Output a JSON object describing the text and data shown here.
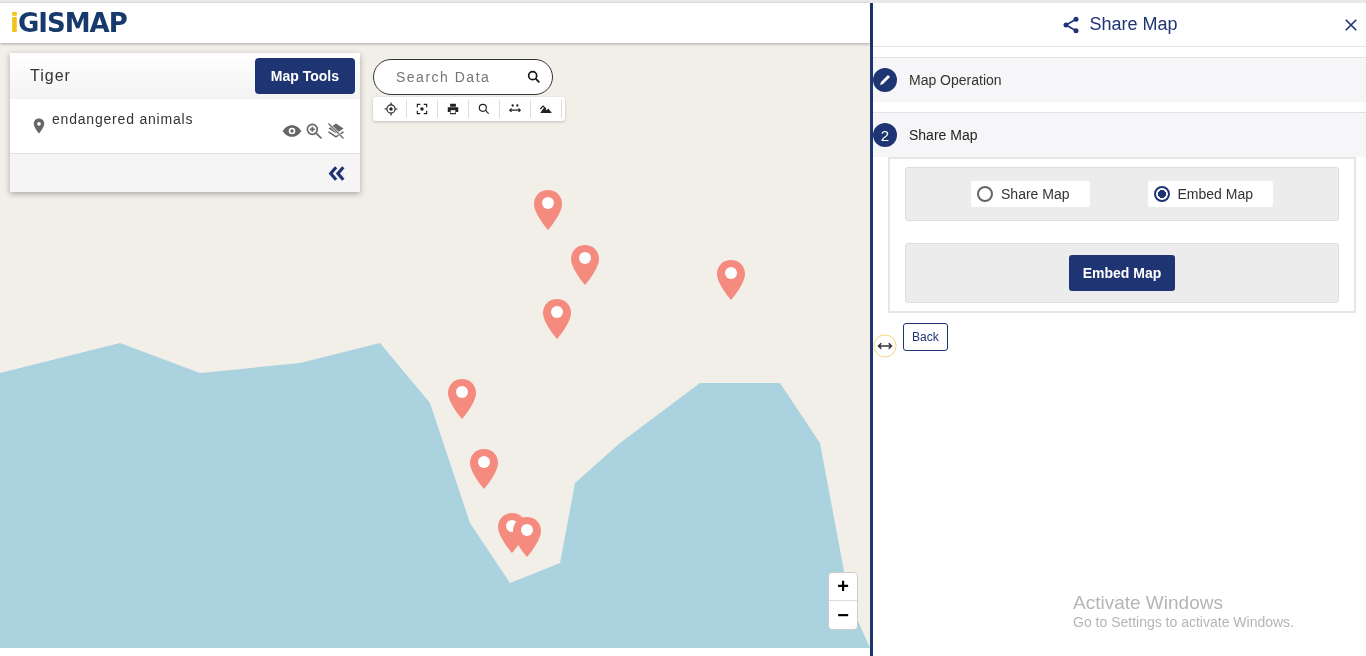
{
  "logo": {
    "text": "iGISMAP"
  },
  "layer_panel": {
    "title": "Tiger",
    "tools_button": "Map Tools",
    "layers": [
      {
        "name": "endangered animals",
        "visible": true
      }
    ]
  },
  "search": {
    "placeholder": "Search Data"
  },
  "zoom_controls": [
    "+",
    "−"
  ],
  "share_panel": {
    "title": "Share Map",
    "steps": [
      {
        "kind": "edit",
        "label": "Map Operation",
        "expanded": false
      },
      {
        "kind": "number",
        "number": "2",
        "label": "Share Map",
        "expanded": true
      }
    ],
    "options": [
      {
        "label": "Share Map",
        "selected": false
      },
      {
        "label": "Embed Map",
        "selected": true
      }
    ],
    "action_button": "Embed Map",
    "back_button": "Back"
  },
  "os_notice": {
    "title": "Activate Windows",
    "text": "Go to Settings to activate Windows."
  }
}
